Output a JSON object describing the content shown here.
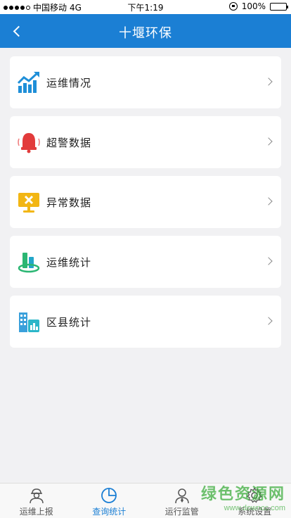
{
  "status_bar": {
    "carrier": "中国移动",
    "network": "4G",
    "time": "下午1:19",
    "battery": "100%"
  },
  "header": {
    "title": "十堰环保"
  },
  "menu": [
    {
      "label": "运维情况",
      "icon": "trend-chart-icon"
    },
    {
      "label": "超警数据",
      "icon": "alarm-bell-icon"
    },
    {
      "label": "异常数据",
      "icon": "error-monitor-icon"
    },
    {
      "label": "运维统计",
      "icon": "stats-bars-icon"
    },
    {
      "label": "区县统计",
      "icon": "district-building-icon"
    }
  ],
  "tabs": [
    {
      "label": "运维上报",
      "icon": "worker-icon",
      "active": false
    },
    {
      "label": "查询统计",
      "icon": "pie-chart-icon",
      "active": true
    },
    {
      "label": "运行监管",
      "icon": "supervisor-icon",
      "active": false
    },
    {
      "label": "系统设置",
      "icon": "gear-icon",
      "active": false
    }
  ],
  "watermark": {
    "main": "绿色资源网",
    "sub": "www.downcc.com"
  },
  "colors": {
    "header": "#1b7fd4",
    "active_tab": "#1b7fd4"
  }
}
